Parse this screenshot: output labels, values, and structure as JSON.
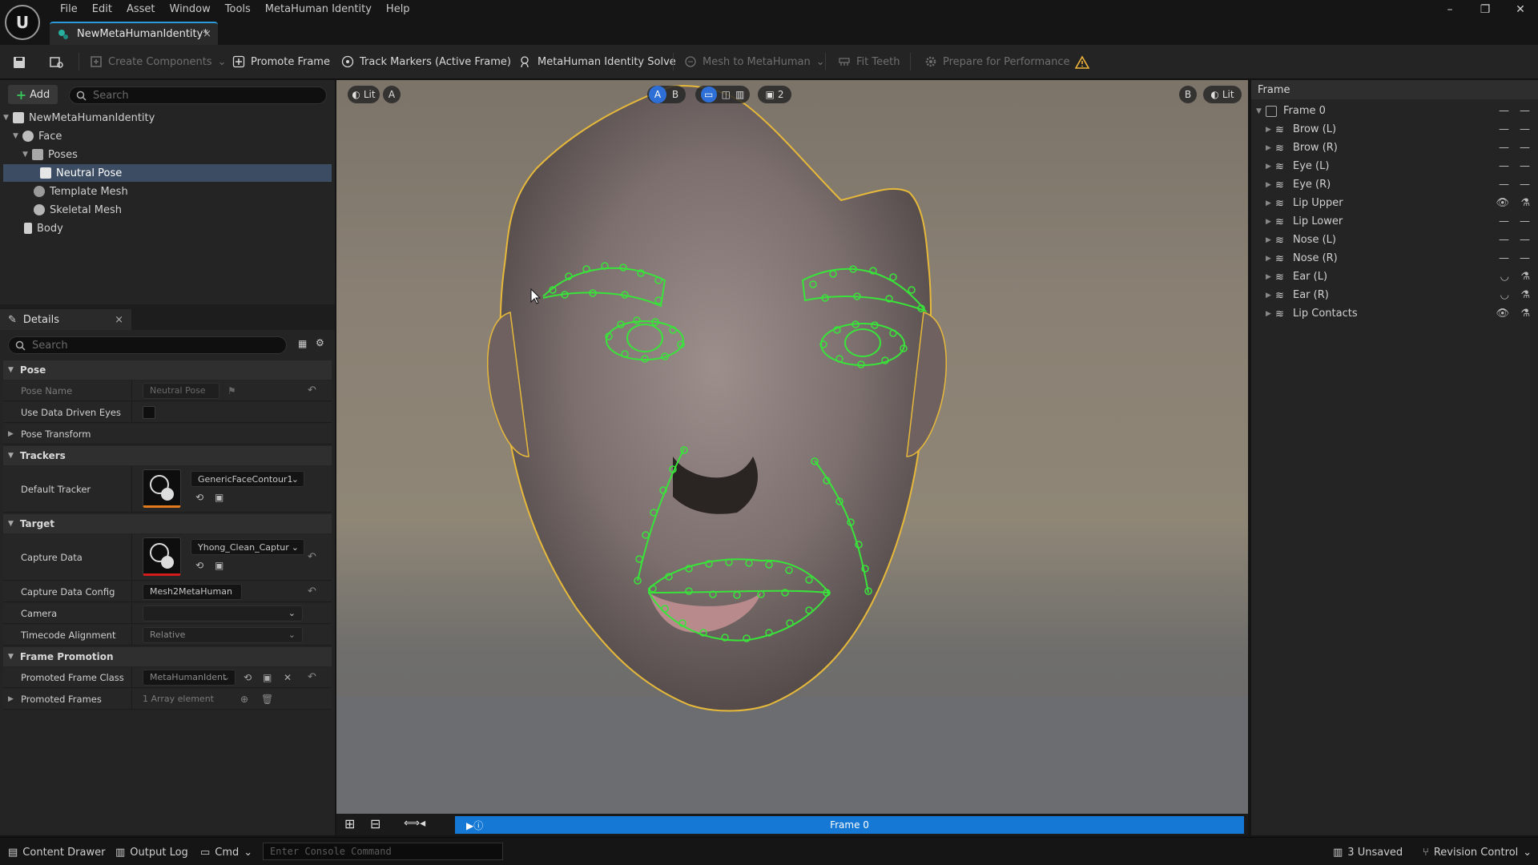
{
  "menu": [
    "File",
    "Edit",
    "Asset",
    "Window",
    "Tools",
    "MetaHuman Identity",
    "Help"
  ],
  "doc_tab": {
    "title": "NewMetaHumanIdentity*"
  },
  "toolbar": {
    "create_components": "Create Components",
    "promote_frame": "Promote Frame",
    "track_markers": "Track Markers (Active Frame)",
    "identity_solve": "MetaHuman Identity Solve",
    "mesh_to_metahuman": "Mesh to MetaHuman",
    "fit_teeth": "Fit Teeth",
    "prepare_performance": "Prepare for Performance"
  },
  "outliner": {
    "add_label": "Add",
    "search_placeholder": "Search",
    "items": [
      "NewMetaHumanIdentity",
      "Face",
      "Poses",
      "Neutral Pose",
      "Template Mesh",
      "Skeletal Mesh",
      "Body"
    ]
  },
  "details": {
    "tab": "Details",
    "search_placeholder": "Search",
    "sections": {
      "pose": "Pose",
      "trackers": "Trackers",
      "target": "Target",
      "frame_promotion": "Frame Promotion"
    },
    "labels": {
      "pose_name": "Pose Name",
      "use_data_driven_eyes": "Use Data Driven Eyes",
      "pose_transform": "Pose Transform",
      "default_tracker": "Default Tracker",
      "capture_data": "Capture Data",
      "capture_data_config": "Capture Data Config",
      "camera": "Camera",
      "timecode_alignment": "Timecode Alignment",
      "promoted_frame_class": "Promoted Frame Class",
      "promoted_frames": "Promoted Frames"
    },
    "values": {
      "pose_name": "Neutral Pose",
      "default_tracker": "GenericFaceContour1",
      "capture_data": "Yhong_Clean_Captur",
      "capture_data_config": "Mesh2MetaHuman",
      "camera": "",
      "timecode_alignment": "Relative",
      "promoted_frame_class": "MetaHumanIdent",
      "promoted_frames": "1 Array element"
    }
  },
  "viewport": {
    "lit_left": "Lit",
    "a_left": "A",
    "ab_a": "A",
    "ab_b": "B",
    "layout_count": "2",
    "b_right": "B",
    "lit_right": "Lit",
    "frame_label": "Frame 0"
  },
  "frame_panel": {
    "header": "Frame",
    "root": "Frame 0",
    "items": [
      "Brow (L)",
      "Brow (R)",
      "Eye (L)",
      "Eye (R)",
      "Lip Upper",
      "Lip Lower",
      "Nose (L)",
      "Nose (R)",
      "Ear (L)",
      "Ear (R)",
      "Lip Contacts"
    ]
  },
  "status": {
    "content_drawer": "Content Drawer",
    "output_log": "Output Log",
    "cmd": "Cmd",
    "console_placeholder": "Enter Console Command",
    "unsaved": "3 Unsaved",
    "revision_control": "Revision Control"
  },
  "colors": {
    "accent": "#1478d4",
    "tracker_green": "#39e43a",
    "outline_yellow": "#e7b93a",
    "add_green": "#39c35b"
  }
}
